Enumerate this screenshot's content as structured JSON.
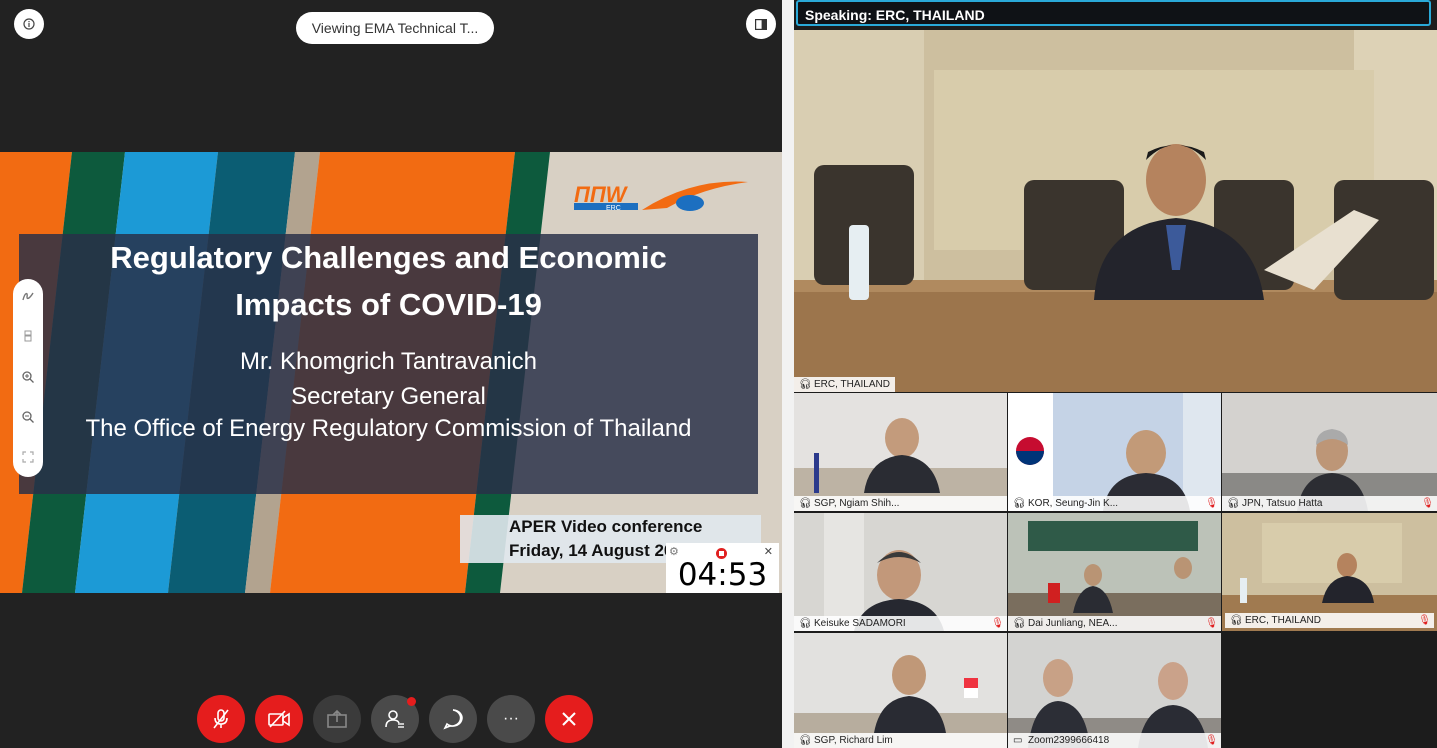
{
  "top_bar": {
    "info_icon": "info-icon",
    "viewing_label": "Viewing EMA Technical T...",
    "split_icon": "split-view-icon"
  },
  "slide": {
    "title_line1": "Regulatory Challenges and Economic",
    "title_line2": "Impacts of COVID-19",
    "presenter": "Mr. Khomgrich Tantravanich",
    "role": "Secretary General",
    "org": "The Office of Energy Regulatory Commission of Thailand",
    "conference_line1": "APER Video conference",
    "conference_line2": "Friday, 14 August 2020",
    "logo_text": "ERC"
  },
  "timer": {
    "value": "04:53"
  },
  "annotation_tools": [
    "pen-icon",
    "eraser-icon",
    "zoom-in-icon",
    "zoom-out-icon",
    "fit-screen-icon"
  ],
  "controls": [
    {
      "name": "mute-button",
      "icon": "microphone-off-icon"
    },
    {
      "name": "video-button",
      "icon": "camera-off-icon"
    },
    {
      "name": "share-button",
      "icon": "share-icon"
    },
    {
      "name": "participants-button",
      "icon": "participants-icon"
    },
    {
      "name": "chat-button",
      "icon": "chat-icon"
    },
    {
      "name": "more-button",
      "icon": "more-icon",
      "label": "···"
    },
    {
      "name": "leave-button",
      "icon": "close-icon"
    }
  ],
  "speaking": {
    "label": "Speaking:",
    "name": "ERC, THAILAND"
  },
  "main_video": {
    "name": "ERC, THAILAND"
  },
  "participants": [
    {
      "name": "SGP, Ngiam Shih...",
      "muted": false
    },
    {
      "name": "KOR, Seung-Jin K...",
      "muted": true
    },
    {
      "name": "JPN, Tatsuo Hatta",
      "muted": true
    },
    {
      "name": "Keisuke SADAMORI",
      "muted": true
    },
    {
      "name": "Dai Junliang, NEA...",
      "muted": true
    },
    {
      "name": "ERC, THAILAND",
      "muted": true
    },
    {
      "name": "SGP, Richard Lim",
      "muted": false
    },
    {
      "name": "Zoom2399666418",
      "muted": true
    }
  ],
  "colors": {
    "accent": "#3db7e8",
    "danger": "#e51d1d",
    "slide_orange": "#f26b12"
  }
}
